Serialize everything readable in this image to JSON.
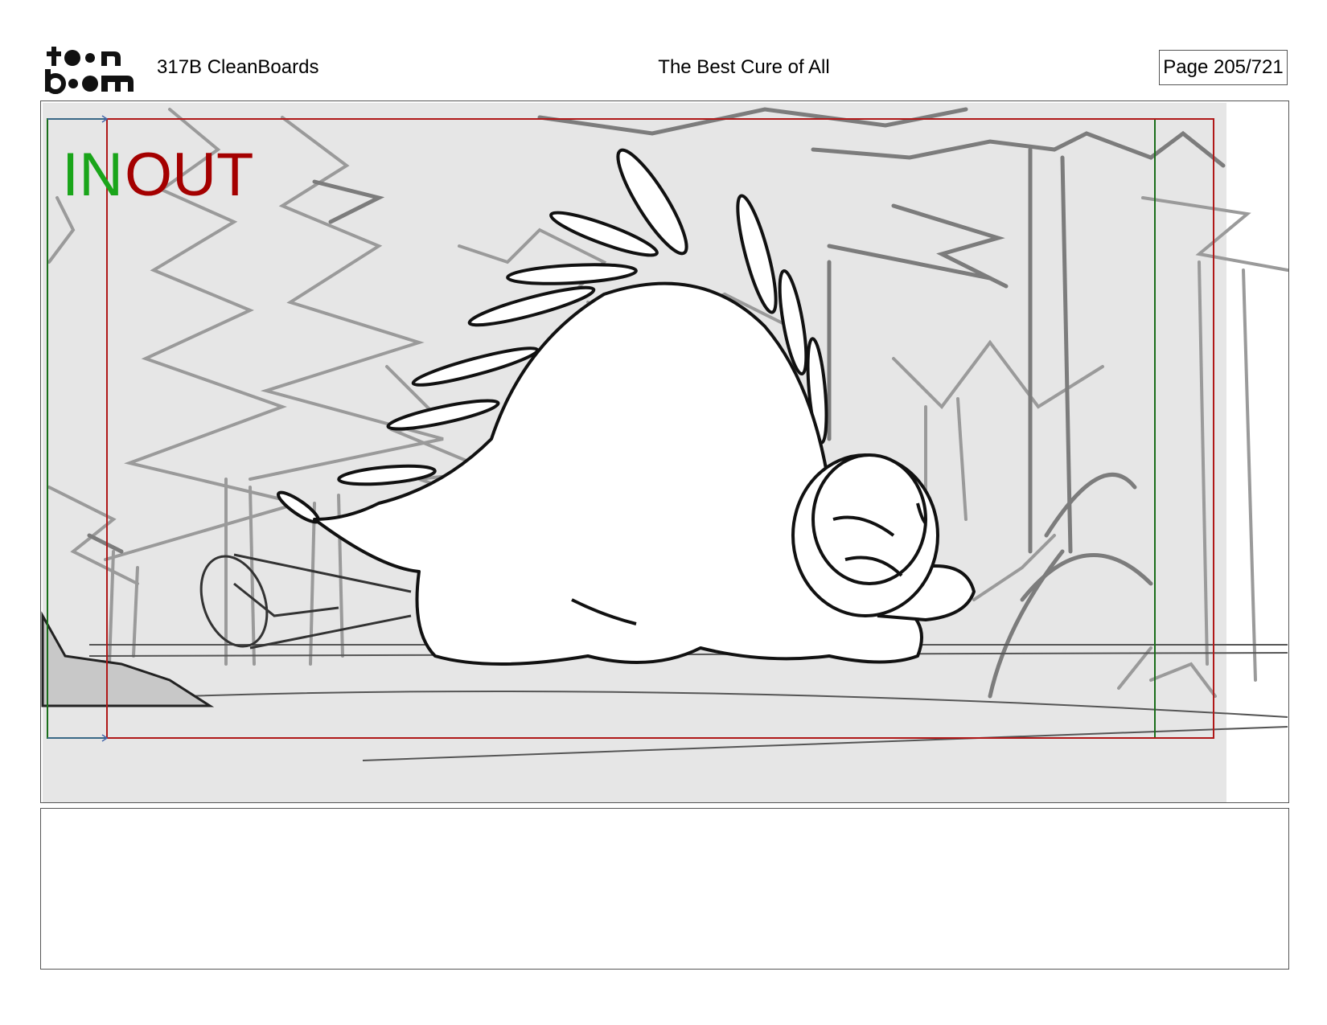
{
  "header": {
    "logo_text": "toon boom",
    "scene_label": "317B  CleanBoards",
    "title": "The Best Cure of All",
    "page_indicator": "Page 205/721"
  },
  "panel": {
    "in_label": "IN",
    "out_label": "OUT",
    "colors": {
      "in_frame": "#1a6e1a",
      "out_frame": "#b01818",
      "background_fill": "#e6e6e6",
      "sketch_gray": "#8a8a8a"
    }
  },
  "notes": {
    "text": ""
  }
}
